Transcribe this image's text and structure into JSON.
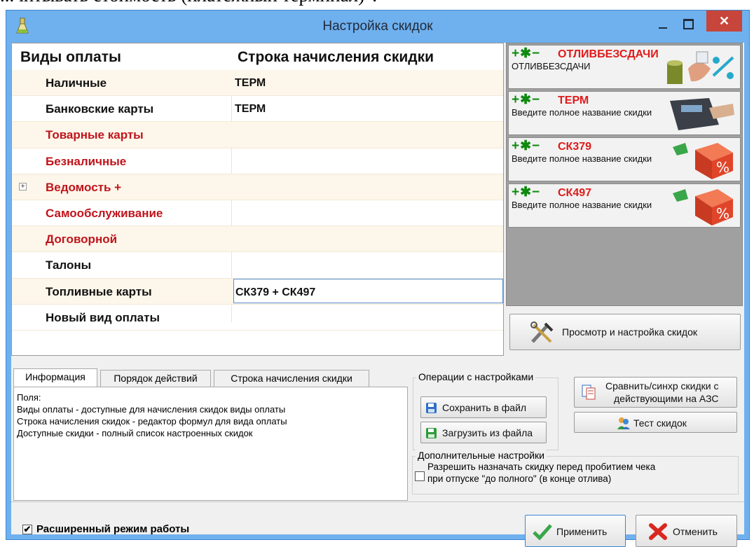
{
  "document": {
    "text": "...читывать стоимость (платежный терминал)\"."
  },
  "window": {
    "title": "Настройка скидок",
    "close_glyph": "✕"
  },
  "grid": {
    "col1_header": "Виды оплаты",
    "col2_header": "Строка начисления скидки",
    "rows": [
      {
        "name": "Наличные",
        "value": "ТЕРМ",
        "color": "#111111"
      },
      {
        "name": "Банковские карты",
        "value": "ТЕРМ",
        "color": "#111111"
      },
      {
        "name": "Товарные карты",
        "value": "",
        "color": "#c0141c"
      },
      {
        "name": "Безналичные",
        "value": "",
        "color": "#c0141c"
      },
      {
        "name": "Ведомость +",
        "value": "",
        "color": "#c0141c",
        "expander": "+"
      },
      {
        "name": "Самообслуживание",
        "value": "",
        "color": "#c0141c"
      },
      {
        "name": "Договорной",
        "value": "",
        "color": "#c0141c"
      },
      {
        "name": "Талоны",
        "value": "",
        "color": "#111111"
      },
      {
        "name": "Топливные карты",
        "value": "СК379 + СК497",
        "color": "#111111"
      },
      {
        "name": "Новый вид оплаты",
        "value": "",
        "color": "#111111"
      }
    ]
  },
  "discounts": [
    {
      "ops": "+✱−",
      "name": "ОТЛИВБЕЗСДАЧИ",
      "desc": "ОТЛИВБЕЗСДАЧИ",
      "icon": "money-hand-icon"
    },
    {
      "ops": "+✱−",
      "name": "ТЕРМ",
      "desc": "Введите полное название скидки",
      "icon": "card-terminal-icon"
    },
    {
      "ops": "+✱−",
      "name": "СК379",
      "desc": "Введите полное название скидки",
      "icon": "percent-cube-icon"
    },
    {
      "ops": "+✱−",
      "name": "СК497",
      "desc": "Введите полное название скидки",
      "icon": "percent-cube-icon"
    }
  ],
  "buttons": {
    "view_discounts": "Просмотр и настройка скидок",
    "save_file": "Сохранить в файл",
    "load_file": "Загрузить из файла",
    "compare_line1": "Сравнить/синхр скидки с",
    "compare_line2": "действующими  на АЗС",
    "test": "Тест скидок",
    "apply": "Применить",
    "cancel": "Отменить"
  },
  "tabs": [
    {
      "label": "Информация",
      "active": true
    },
    {
      "label": "Порядок действий",
      "active": false
    },
    {
      "label": "Строка начисления скидки",
      "active": false
    }
  ],
  "info_lines": [
    "Поля:",
    "Виды оплаты - доступные для начисления скидок виды оплаты",
    "Строка начисления скидок - редактор формул для вида оплаты",
    "Доступные скидки - полный список настроенных скидок"
  ],
  "groups": {
    "operations": "Операции с настройками",
    "additional": "Дополнительные настройки",
    "allow_line1": "Разрешить назначать скидку перед пробитием чека",
    "allow_line2": "при отпуске \"до полного\" (в конце отлива)",
    "allow_checked": false
  },
  "extended_mode": {
    "label": "Расширенный режим работы",
    "checked": true,
    "check_glyph": "✔"
  },
  "colors": {
    "title_bg": "#6fb0ee",
    "close_bg": "#c7453a",
    "accent_red": "#e01b1b",
    "ops_green": "#0f8a10",
    "row_alt": "#fdf6ea"
  }
}
